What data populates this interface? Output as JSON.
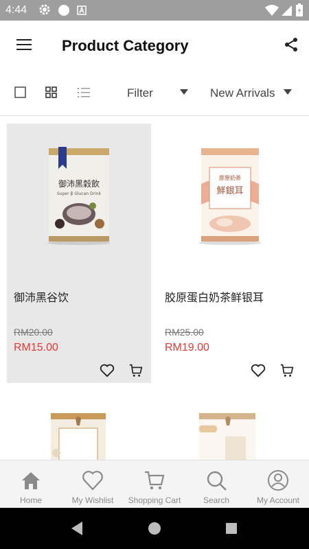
{
  "status_bar": {
    "time": "4:44",
    "icons": [
      "gear-icon",
      "circle-icon",
      "sim-icon",
      "wifi-icon",
      "signal-icon",
      "battery-charging-icon"
    ]
  },
  "app_bar": {
    "title": "Product Category",
    "menu_icon": "hamburger-icon",
    "share_icon": "share-icon"
  },
  "toolbar": {
    "view_icons": [
      "checkbox-view-icon",
      "grid-view-icon",
      "list-view-icon"
    ],
    "filter_label": "Filter",
    "sort_label": "New Arrivals"
  },
  "products": [
    {
      "name": "御沛黑谷饮",
      "old_price": "RM20.00",
      "price": "RM15.00",
      "can_text": "御沛黑穀飲",
      "can_subtext": "Super β Glucan Drink",
      "highlighted": true
    },
    {
      "name": "胶原蛋白奶茶鲜银耳",
      "old_price": "RM25.00",
      "price": "RM19.00",
      "can_text": "鮮銀耳",
      "can_subtext": "膠原奶茶",
      "highlighted": false
    }
  ],
  "bottom_nav": [
    {
      "label": "Home",
      "icon": "home-icon"
    },
    {
      "label": "My Wishlist",
      "icon": "heart-icon"
    },
    {
      "label": "Shopping Cart",
      "icon": "cart-icon"
    },
    {
      "label": "Search",
      "icon": "search-icon"
    },
    {
      "label": "My Account",
      "icon": "account-icon"
    }
  ],
  "colors": {
    "price_red": "#e53935",
    "status_bar": "#9e9e9e",
    "nav_gray": "#8a8a8a"
  }
}
